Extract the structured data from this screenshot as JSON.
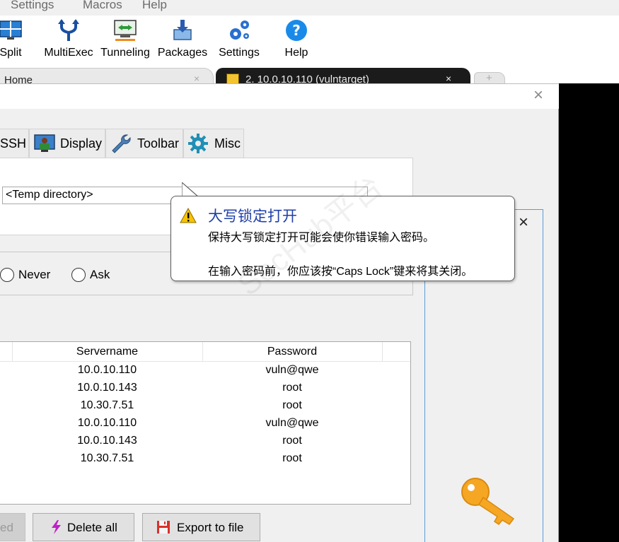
{
  "menubar": {
    "items": [
      "Settings",
      "Macros",
      "Help"
    ]
  },
  "toolbar": {
    "buttons": [
      {
        "label": "Split",
        "icon": "split-icon"
      },
      {
        "label": "MultiExec",
        "icon": "multiexec-icon"
      },
      {
        "label": "Tunneling",
        "icon": "tunneling-icon"
      },
      {
        "label": "Packages",
        "icon": "packages-icon"
      },
      {
        "label": "Settings",
        "icon": "settings-gears-icon"
      },
      {
        "label": "Help",
        "icon": "help-icon"
      }
    ]
  },
  "tabs": {
    "home_label": "Home",
    "active_label": "2. 10.0.10.110 (vulntarget)",
    "close_glyph": "×"
  },
  "dialog": {
    "close_glyph": "×",
    "setting_tabs": [
      {
        "label": "SSH",
        "icon": "ssh-icon"
      },
      {
        "label": "Display",
        "icon": "display-icon"
      },
      {
        "label": "Toolbar",
        "icon": "wrench-icon"
      },
      {
        "label": "Misc",
        "icon": "gear-icon"
      }
    ],
    "temp_directory_value": "<Temp directory>",
    "radio_options": [
      "Never",
      "Ask"
    ],
    "passwords": {
      "columns": [
        "Servername",
        "Password"
      ],
      "rows": [
        {
          "server": "10.0.10.110",
          "password": "vuln@qwe"
        },
        {
          "server": "10.0.10.143",
          "password": "root"
        },
        {
          "server": "10.30.7.51",
          "password": "root"
        },
        {
          "server": "10.0.10.110",
          "password": "vuln@qwe"
        },
        {
          "server": "10.0.10.143",
          "password": "root"
        },
        {
          "server": "10.30.7.51",
          "password": "root"
        }
      ]
    },
    "buttons": {
      "partial_label": "ed",
      "delete_all": "Delete all",
      "export": "Export to file"
    }
  },
  "caps_lock_tooltip": {
    "title": "大写锁定打开",
    "line1": "保持大写锁定打开可能会使你错误输入密码。",
    "line2": "在输入密码前，你应该按“Caps Lock”键来将其关闭。"
  },
  "password_popup": {
    "close_glyph": "×"
  },
  "watermark": "SecHub平台",
  "colors": {
    "tooltip_title": "#1f3fa8",
    "active_tab_bg": "#1b1b1b",
    "popup_border": "#5b9bd5",
    "key_icon": "#f5a623"
  }
}
